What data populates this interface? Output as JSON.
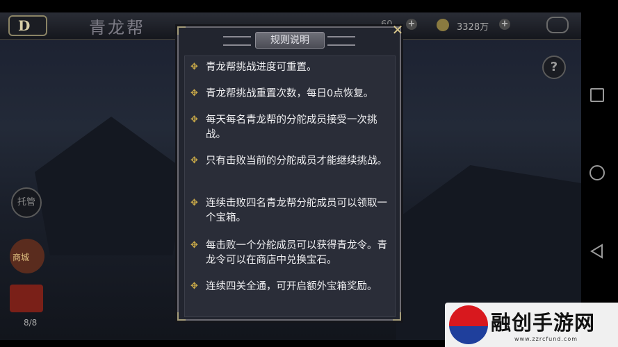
{
  "header": {
    "back_label": "D",
    "title": "青龙帮",
    "resource_count": "60",
    "gold_amount": "3328万"
  },
  "side_buttons": {
    "help_label": "?",
    "auto_label": "托管",
    "shop_label": "商城",
    "chest_count": "8/8"
  },
  "modal": {
    "title": "规则说明",
    "close_label": "✕",
    "rules": [
      "青龙帮挑战进度可重置。",
      "青龙帮挑战重置次数，每日0点恢复。",
      "每天每名青龙帮的分舵成员接受一次挑战。",
      "只有击败当前的分舵成员才能继续挑战。",
      "连续击败四名青龙帮分舵成员可以领取一个宝箱。",
      "每击败一个分舵成员可以获得青龙令。青龙令可以在商店中兑换宝石。",
      "连续四关全通，可开启额外宝箱奖励。"
    ]
  },
  "watermark": {
    "name": "融创手游网",
    "url": "www.zzrcfund.com"
  },
  "colors": {
    "accent_gold": "#c9a948",
    "modal_bg": "#22252f",
    "watermark_red": "#d8181e",
    "watermark_blue": "#1f3f9c"
  },
  "icons": [
    "back-icon",
    "gear-icon",
    "coin-icon",
    "chat-icon",
    "help-icon",
    "close-icon",
    "diamond-bullet-icon",
    "home-circle-icon",
    "recent-square-icon",
    "back-triangle-icon"
  ]
}
